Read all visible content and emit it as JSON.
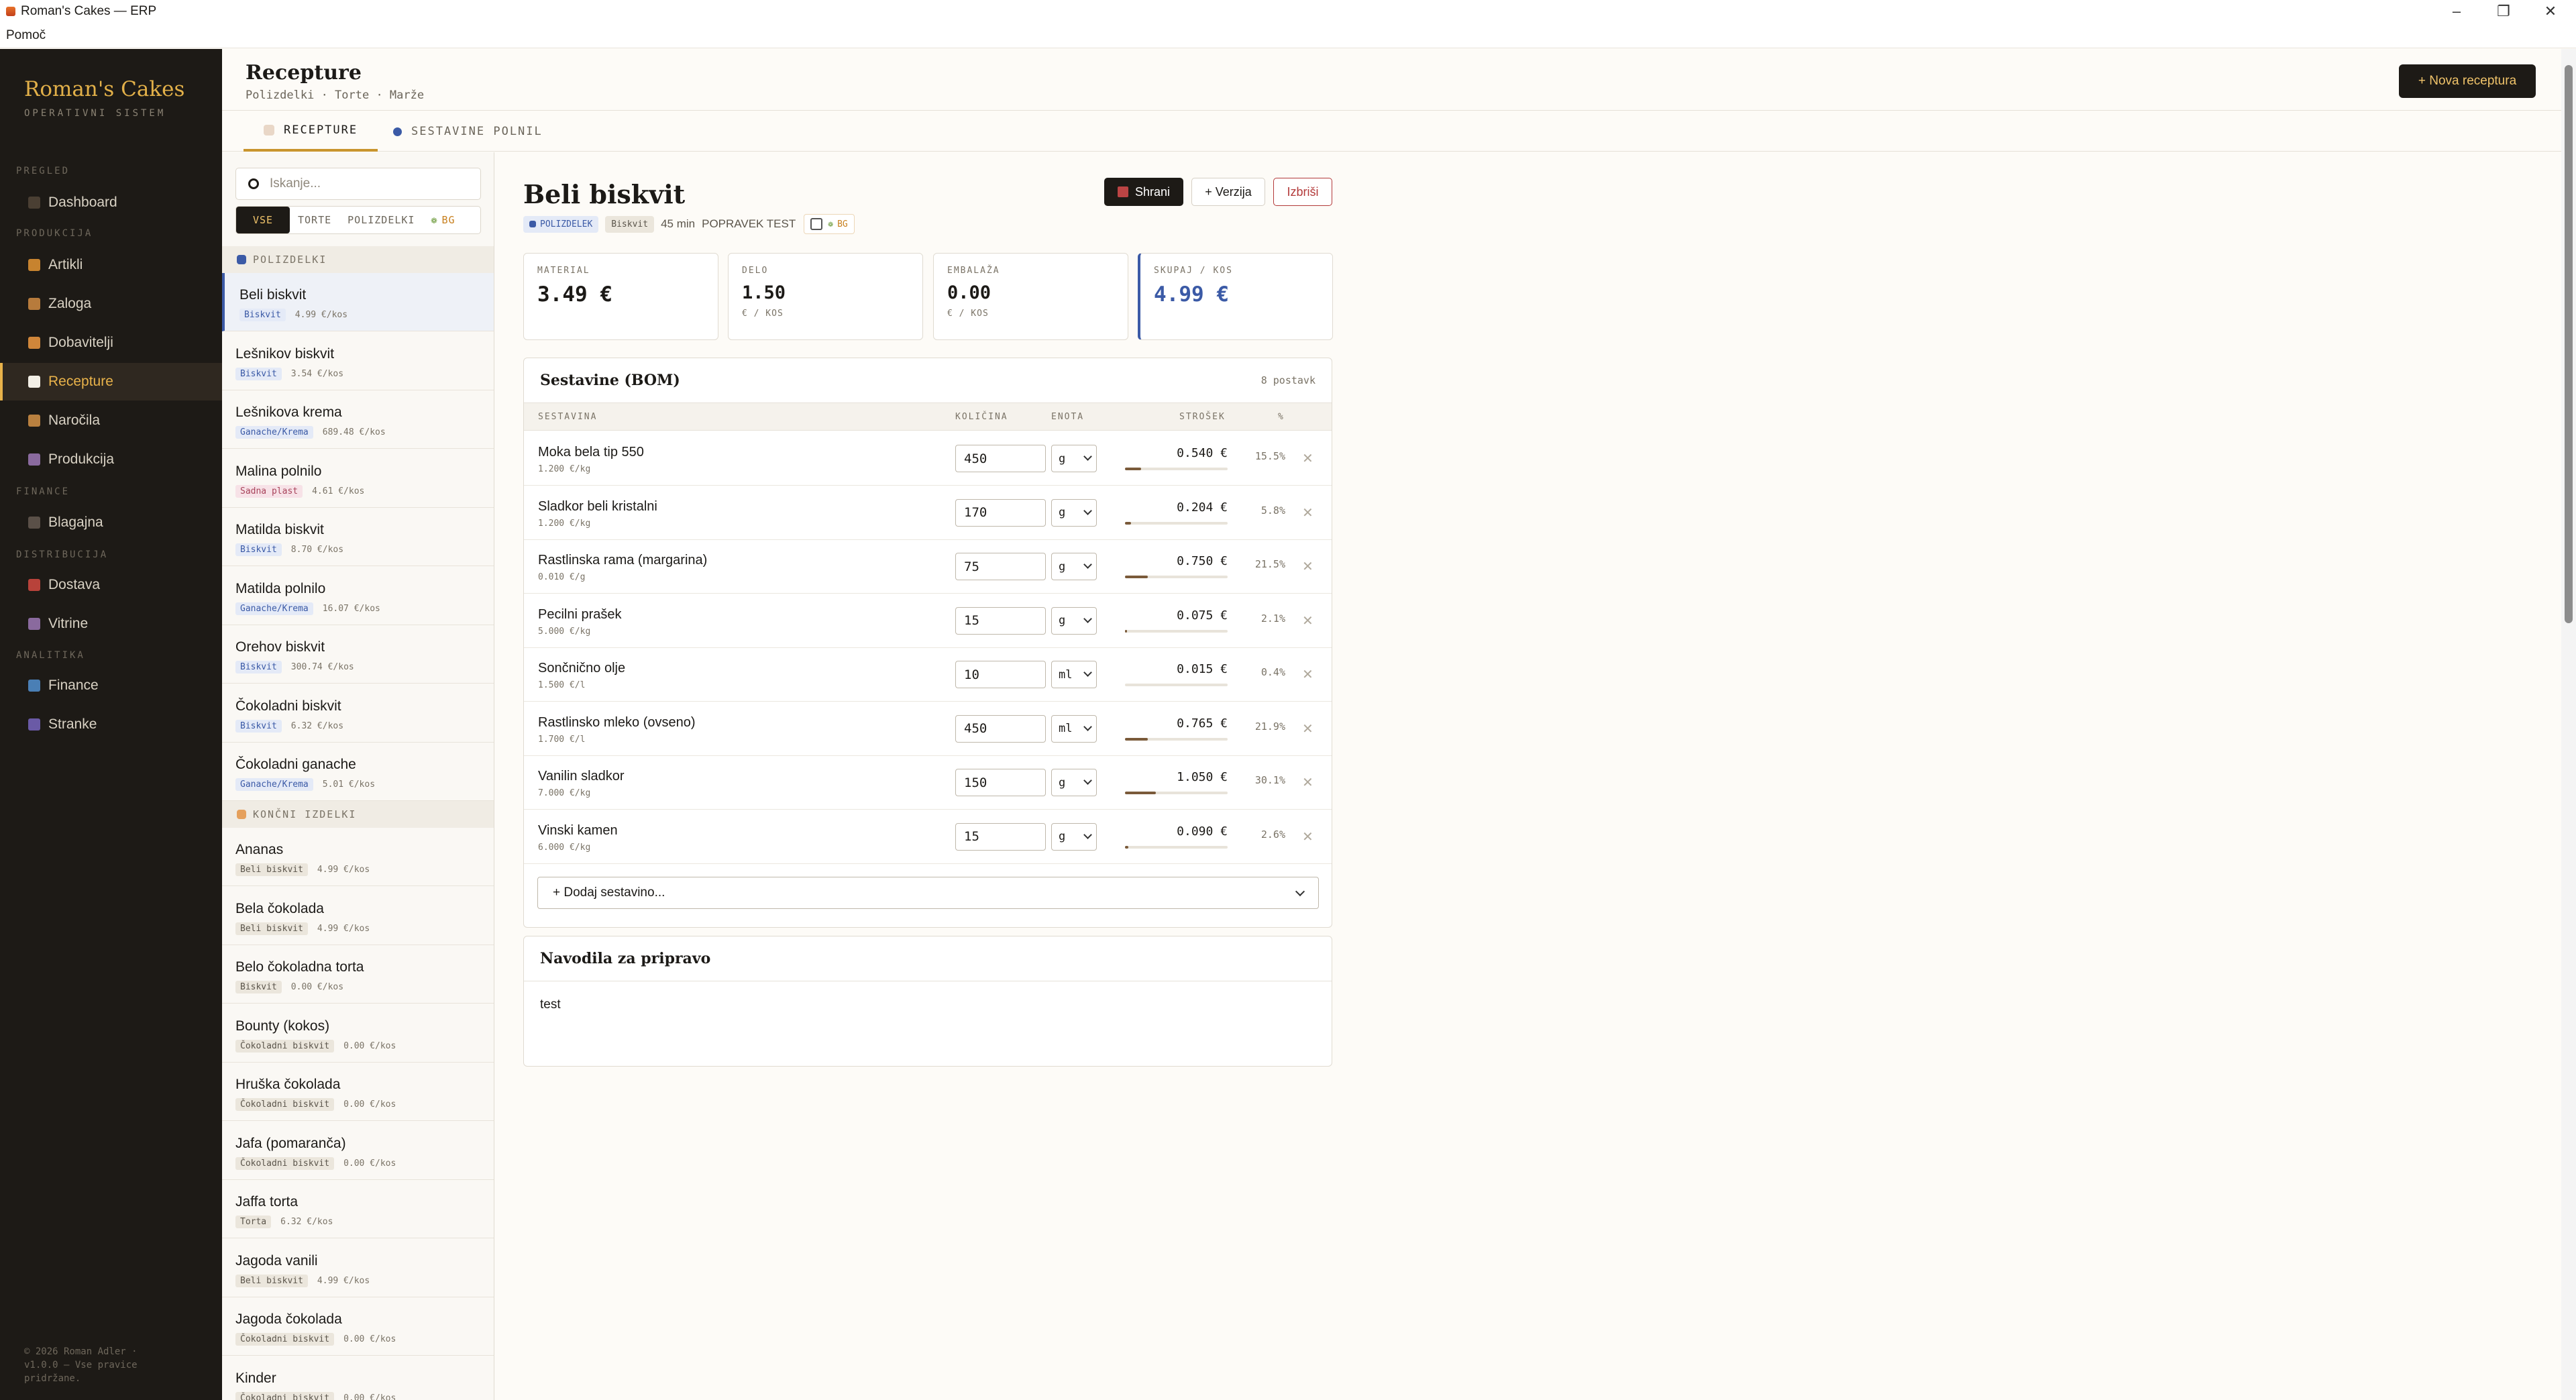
{
  "window": {
    "title": "Roman's Cakes — ERP",
    "menu_help": "Pomoč"
  },
  "sidebar": {
    "brand": "Roman's Cakes",
    "brand_sub": "OPERATIVNI SISTEM",
    "sections": {
      "pregled": "PREGLED",
      "produkcija": "PRODUKCIJA",
      "finance": "FINANCE",
      "distribucija": "DISTRIBUCIJA",
      "analitika": "ANALITIKA"
    },
    "items": {
      "dashboard": "Dashboard",
      "artikli": "Artikli",
      "zaloga": "Zaloga",
      "dobavitelji": "Dobavitelji",
      "recepture": "Recepture",
      "narocila": "Naročila",
      "produkcija": "Produkcija",
      "blagajna": "Blagajna",
      "dostava": "Dostava",
      "vitrine": "Vitrine",
      "finance": "Finance",
      "stranke": "Stranke"
    },
    "footer": "© 2026 Roman Adler · v1.0.0 — Vse pravice pridržane."
  },
  "header": {
    "title": "Recepture",
    "subtitle": "Polizdelki · Torte · Marže",
    "new_button": "+ Nova receptura"
  },
  "tabs": {
    "recepture": "RECEPTURE",
    "sestavine": "SESTAVINE POLNIL"
  },
  "list": {
    "search_placeholder": "Iskanje...",
    "filters": {
      "all": "VSE",
      "torte": "TORTE",
      "polizdelki": "POLIZDELKI",
      "bg": "BG"
    },
    "group_polizdelki": "POLIZDELKI",
    "group_koncni": "KONČNI IZDELKI",
    "items": [
      {
        "name": "Beli biskvit",
        "tag": "Biskvit",
        "price": "4.99 €/kos"
      },
      {
        "name": "Lešnikov biskvit",
        "tag": "Biskvit",
        "price": "3.54 €/kos"
      },
      {
        "name": "Lešnikova krema",
        "tag": "Ganache/Krema",
        "price": "689.48 €/kos"
      },
      {
        "name": "Malina polnilo",
        "tag": "Sadna plast",
        "price": "4.61 €/kos"
      },
      {
        "name": "Matilda biskvit",
        "tag": "Biskvit",
        "price": "8.70 €/kos"
      },
      {
        "name": "Matilda polnilo",
        "tag": "Ganache/Krema",
        "price": "16.07 €/kos"
      },
      {
        "name": "Orehov biskvit",
        "tag": "Biskvit",
        "price": "300.74 €/kos"
      },
      {
        "name": "Čokoladni biskvit",
        "tag": "Biskvit",
        "price": "6.32 €/kos"
      },
      {
        "name": "Čokoladni ganache",
        "tag": "Ganache/Krema",
        "price": "5.01 €/kos"
      }
    ],
    "final_items": [
      {
        "name": "Ananas",
        "tag": "Beli biskvit",
        "price": "4.99 €/kos"
      },
      {
        "name": "Bela čokolada",
        "tag": "Beli biskvit",
        "price": "4.99 €/kos"
      },
      {
        "name": "Belo čokoladna torta",
        "tag": "Biskvit",
        "price": "0.00 €/kos"
      },
      {
        "name": "Bounty (kokos)",
        "tag": "Čokoladni biskvit",
        "price": "0.00 €/kos"
      },
      {
        "name": "Hruška čokolada",
        "tag": "Čokoladni biskvit",
        "price": "0.00 €/kos"
      },
      {
        "name": "Jafa (pomaranča)",
        "tag": "Čokoladni biskvit",
        "price": "0.00 €/kos"
      },
      {
        "name": "Jaffa torta",
        "tag": "Torta",
        "price": "6.32 €/kos"
      },
      {
        "name": "Jagoda vanili",
        "tag": "Beli biskvit",
        "price": "4.99 €/kos"
      },
      {
        "name": "Jagoda čokolada",
        "tag": "Čokoladni biskvit",
        "price": "0.00 €/kos"
      },
      {
        "name": "Kinder",
        "tag": "Čokoladni biskvit",
        "price": "0.00 €/kos"
      }
    ]
  },
  "detail": {
    "title": "Beli biskvit",
    "chip_type": "POLIZDELEK",
    "chip_cat": "Biskvit",
    "time": "45 min",
    "note": "POPRAVEK TEST",
    "chip_bg": "BG",
    "buttons": {
      "save": "Shrani",
      "version": "+ Verzija",
      "delete": "Izbriši"
    },
    "kpis": {
      "material": {
        "label": "MATERIAL",
        "value": "3.49 €"
      },
      "delo": {
        "label": "DELO",
        "value": "1.50",
        "unit": "€ / KOS"
      },
      "embalaza": {
        "label": "EMBALAŽA",
        "value": "0.00",
        "unit": "€ / KOS"
      },
      "skupaj": {
        "label": "SKUPAJ / KOS",
        "value": "4.99 €"
      }
    },
    "bom": {
      "title": "Sestavine (BOM)",
      "count": "8 postavk",
      "headers": {
        "sestavina": "SESTAVINA",
        "kolicina": "KOLIČINA",
        "enota": "ENOTA",
        "strosek": "STROŠEK",
        "pct": "%"
      },
      "rows": [
        {
          "name": "Moka bela tip 550",
          "price": "1.200 €/kg",
          "qty": "450",
          "unit": "g",
          "cost": "0.540 €",
          "pct": "15.5%",
          "share": 0.155
        },
        {
          "name": "Sladkor beli kristalni",
          "price": "1.200 €/kg",
          "qty": "170",
          "unit": "g",
          "cost": "0.204 €",
          "pct": "5.8%",
          "share": 0.058
        },
        {
          "name": "Rastlinska rama (margarina)",
          "price": "0.010 €/g",
          "qty": "75",
          "unit": "g",
          "cost": "0.750 €",
          "pct": "21.5%",
          "share": 0.215
        },
        {
          "name": "Pecilni prašek",
          "price": "5.000 €/kg",
          "qty": "15",
          "unit": "g",
          "cost": "0.075 €",
          "pct": "2.1%",
          "share": 0.021
        },
        {
          "name": "Sončnično olje",
          "price": "1.500 €/l",
          "qty": "10",
          "unit": "ml",
          "cost": "0.015 €",
          "pct": "0.4%",
          "share": 0.004
        },
        {
          "name": "Rastlinsko mleko (ovseno)",
          "price": "1.700 €/l",
          "qty": "450",
          "unit": "ml",
          "cost": "0.765 €",
          "pct": "21.9%",
          "share": 0.219
        },
        {
          "name": "Vanilin sladkor",
          "price": "7.000 €/kg",
          "qty": "150",
          "unit": "g",
          "cost": "1.050 €",
          "pct": "30.1%",
          "share": 0.301
        },
        {
          "name": "Vinski kamen",
          "price": "6.000 €/kg",
          "qty": "15",
          "unit": "g",
          "cost": "0.090 €",
          "pct": "2.6%",
          "share": 0.026
        }
      ],
      "add_placeholder": "+ Dodaj sestavino..."
    },
    "instructions": {
      "title": "Navodila za pripravo",
      "text": "test"
    }
  },
  "colors": {
    "accent": "#e8b24a",
    "dark": "#1d1a16",
    "blue": "#3b5aa6",
    "delete": "#b33a3a"
  }
}
